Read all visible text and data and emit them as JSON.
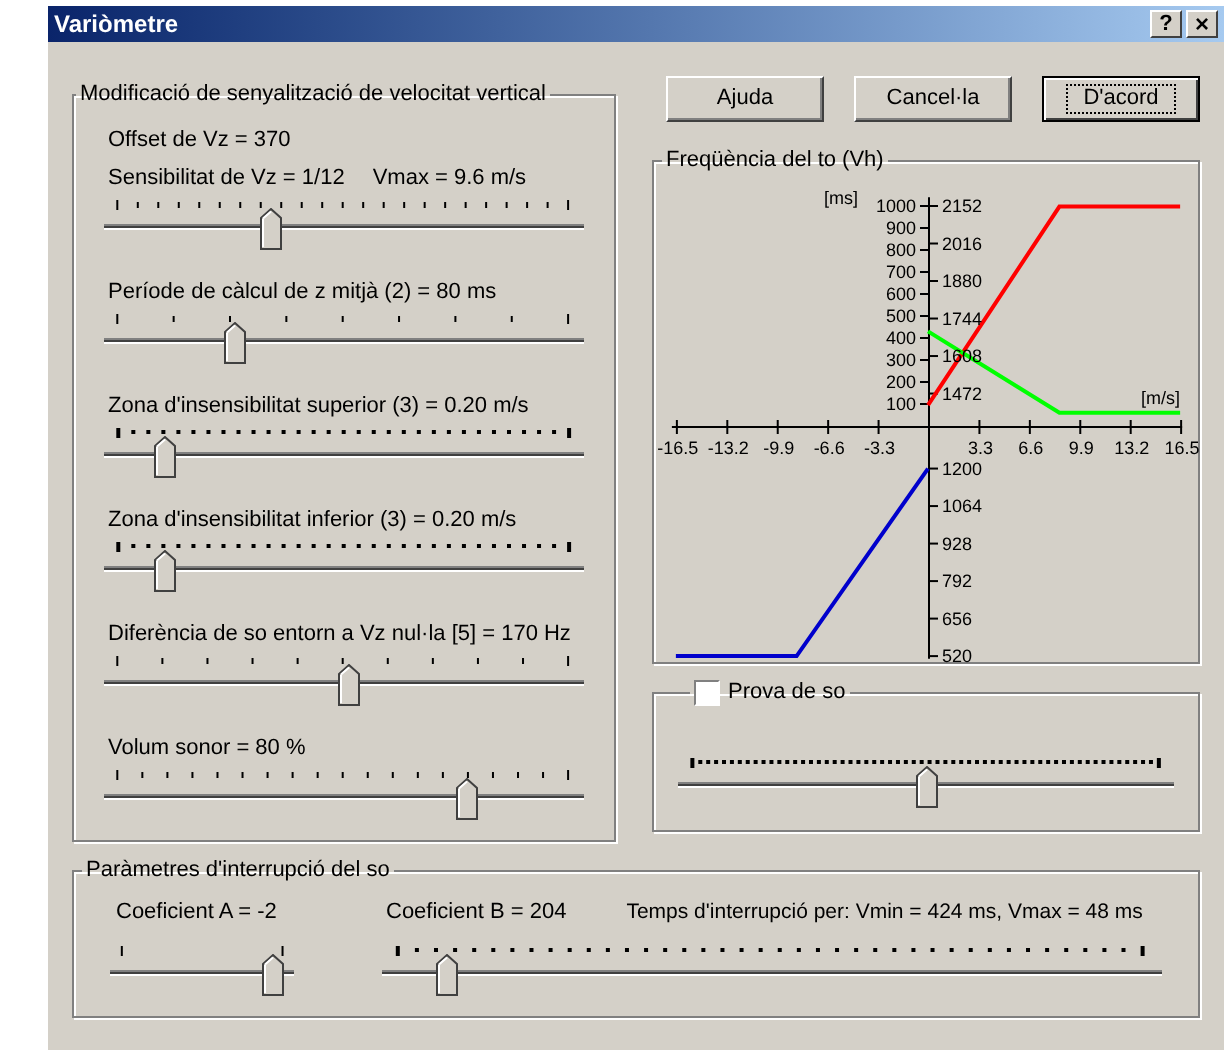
{
  "window": {
    "title": "Variòmetre",
    "help_button": "?",
    "close_button": "×"
  },
  "buttons": [
    {
      "label": "Ajuda",
      "default": false
    },
    {
      "label": "Cancel·la",
      "default": false
    },
    {
      "label": "D'acord",
      "default": true
    }
  ],
  "vertical_speed": {
    "title": "Modificació de senyalització de velocitat vertical",
    "offset": "Offset de Vz = 370",
    "sliders": [
      {
        "label": "Sensibilitat de Vz = 1/12",
        "extra": "Vmax = 9.6 m/s",
        "level": 0.34
      },
      {
        "label": "Període de càlcul de z mitjà (2) = 80 ms",
        "level": 0.26
      },
      {
        "label": "Zona d'insensibilitat superior (3) = 0.20 m/s",
        "level": 0.11
      },
      {
        "label": "Zona d'insensibilitat inferior (3) = 0.20 m/s",
        "level": 0.11
      },
      {
        "label": "Diferència de so entorn a Vz nul·la [5] = 170 Hz",
        "level": 0.51
      },
      {
        "label": "Volum sonor = 80 %",
        "level": 0.77
      }
    ]
  },
  "tone_chart": {
    "chart_data": {
      "type": "line",
      "title": "Freqüència del to (Vh)",
      "xlabel": "[m/s]",
      "ylabel": "[ms]",
      "x": [
        -16.5,
        -8.6,
        0,
        8.6,
        16.5
      ],
      "xlim": [
        -16.5,
        16.5
      ],
      "ylim": [
        -1050,
        1040
      ],
      "y2lim": [
        510,
        2180
      ],
      "series": [
        {
          "color": "#ff0000",
          "axis": "y2",
          "values": [
            null,
            null,
            1430,
            2150,
            2150
          ]
        },
        {
          "color": "#00ff00",
          "values": [
            null,
            null,
            430,
            60,
            60
          ]
        },
        {
          "color": "#0000cc",
          "axis": "y2",
          "values": [
            520,
            520,
            1200,
            null,
            null
          ]
        }
      ],
      "xticks": [
        -16.5,
        -13.2,
        -9.9,
        -6.6,
        -3.3,
        3.3,
        6.6,
        9.9,
        13.2,
        16.5
      ],
      "yticks": [
        100,
        200,
        300,
        400,
        500,
        600,
        700,
        800,
        900,
        1000
      ],
      "y2ticks": [
        1472,
        1608,
        1744,
        1880,
        2016,
        2152,
        520,
        656,
        792,
        928,
        1064,
        1200
      ]
    }
  },
  "sound_test": {
    "label": "Prova de so",
    "checked": false,
    "slider": {
      "level": 0.5
    }
  },
  "interruption": {
    "title": "Paràmetres d'interrupció del so",
    "coefficient_a": {
      "label": "Coeficient A = -2",
      "level": 0.94
    },
    "coefficient_b": {
      "label": "Coeficient B = 204",
      "level": 0.07
    },
    "time": "Temps d'interrupció per: Vmin = 424 ms, Vmax = 48 ms"
  }
}
